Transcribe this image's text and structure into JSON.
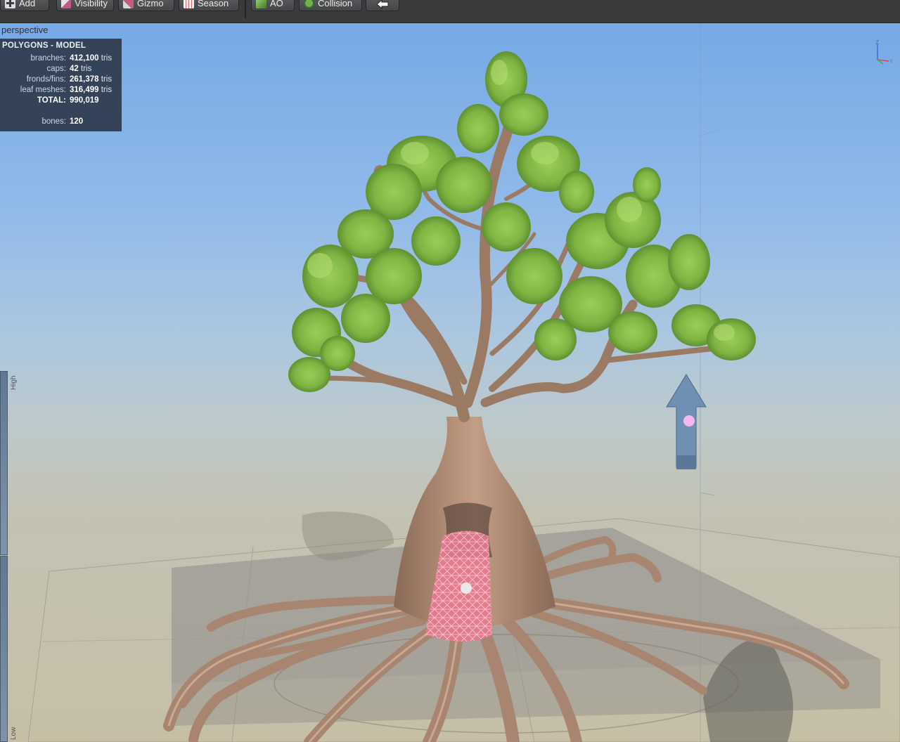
{
  "toolbar": {
    "buttons": [
      {
        "label": "Add",
        "icon": "add-icon"
      },
      {
        "label": "Visibility",
        "icon": "visibility-icon"
      },
      {
        "label": "Gizmo",
        "icon": "gizmo-icon"
      },
      {
        "label": "Season",
        "icon": "season-icon"
      },
      {
        "label": "AO",
        "icon": "ao-cube-icon"
      },
      {
        "label": "Collision",
        "icon": "collision-icon"
      },
      {
        "label": "",
        "icon": "arrow-left-icon"
      }
    ]
  },
  "viewport": {
    "view_name": "perspective",
    "stats": {
      "title": "POLYGONS - MODEL",
      "rows": [
        {
          "label": "branches:",
          "value": "412,100",
          "unit": "tris"
        },
        {
          "label": "caps:",
          "value": "42",
          "unit": "tris"
        },
        {
          "label": "fronds/fins:",
          "value": "261,378",
          "unit": "tris"
        },
        {
          "label": "leaf meshes:",
          "value": "316,499",
          "unit": "tris"
        },
        {
          "label": "TOTAL:",
          "value": "990,019",
          "unit": ""
        },
        {
          "label": "bones:",
          "value": "120",
          "unit": ""
        }
      ]
    },
    "lod": {
      "high_label": "High",
      "low_label": "Low"
    },
    "axis": {
      "z": "Z",
      "y": "Y",
      "x": "X"
    },
    "colors": {
      "sky_top": "#76a9e6",
      "ground": "#c6bfa6",
      "leaf": "#8cc34f",
      "bark": "#b08a70",
      "collision": "#e86a8a",
      "wind_arrow": "#6f8fb3"
    }
  }
}
